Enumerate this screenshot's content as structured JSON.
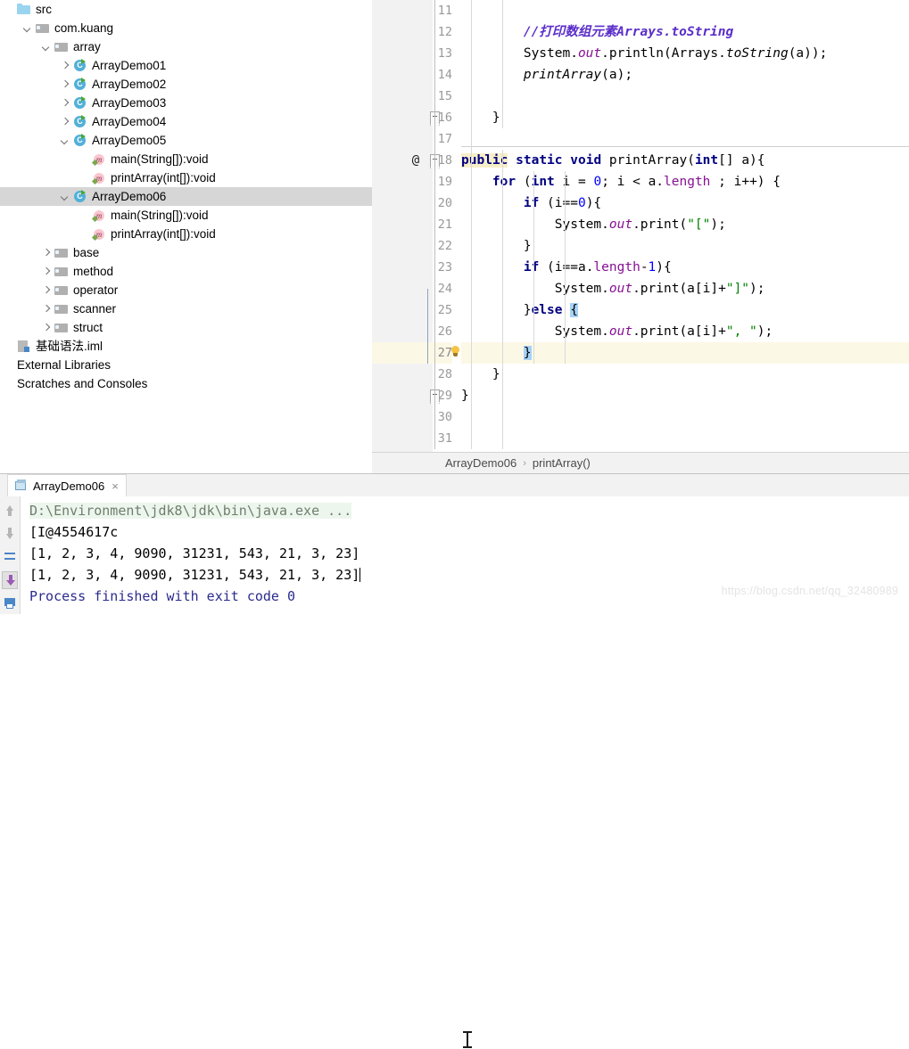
{
  "sidebar": {
    "items": [
      {
        "label": "src",
        "indent": 0,
        "arrow": "none",
        "icon": "folder-src-icon",
        "selected": false
      },
      {
        "label": "com.kuang",
        "indent": 1,
        "arrow": "down",
        "icon": "folder-pkg-icon",
        "selected": false
      },
      {
        "label": "array",
        "indent": 2,
        "arrow": "down",
        "icon": "folder-pkg-icon",
        "selected": false
      },
      {
        "label": "ArrayDemo01",
        "indent": 3,
        "arrow": "right",
        "icon": "java-class-icon",
        "selected": false
      },
      {
        "label": "ArrayDemo02",
        "indent": 3,
        "arrow": "right",
        "icon": "java-class-icon",
        "selected": false
      },
      {
        "label": "ArrayDemo03",
        "indent": 3,
        "arrow": "right",
        "icon": "java-class-icon",
        "selected": false
      },
      {
        "label": "ArrayDemo04",
        "indent": 3,
        "arrow": "right",
        "icon": "java-class-icon",
        "selected": false
      },
      {
        "label": "ArrayDemo05",
        "indent": 3,
        "arrow": "down",
        "icon": "java-class-icon",
        "selected": false
      },
      {
        "label": "main(String[]):void",
        "indent": 4,
        "arrow": "none",
        "icon": "method-icon",
        "selected": false
      },
      {
        "label": "printArray(int[]):void",
        "indent": 4,
        "arrow": "none",
        "icon": "method-icon",
        "selected": false
      },
      {
        "label": "ArrayDemo06",
        "indent": 3,
        "arrow": "down",
        "icon": "java-class-icon",
        "selected": true
      },
      {
        "label": "main(String[]):void",
        "indent": 4,
        "arrow": "none",
        "icon": "method-icon",
        "selected": false
      },
      {
        "label": "printArray(int[]):void",
        "indent": 4,
        "arrow": "none",
        "icon": "method-icon",
        "selected": false
      },
      {
        "label": "base",
        "indent": 2,
        "arrow": "right",
        "icon": "folder-pkg-icon",
        "selected": false
      },
      {
        "label": "method",
        "indent": 2,
        "arrow": "right",
        "icon": "folder-pkg-icon",
        "selected": false
      },
      {
        "label": "operator",
        "indent": 2,
        "arrow": "right",
        "icon": "folder-pkg-icon",
        "selected": false
      },
      {
        "label": "scanner",
        "indent": 2,
        "arrow": "right",
        "icon": "folder-pkg-icon",
        "selected": false
      },
      {
        "label": "struct",
        "indent": 2,
        "arrow": "right",
        "icon": "folder-pkg-icon",
        "selected": false
      },
      {
        "label": "基础语法.iml",
        "indent": 0,
        "arrow": "none",
        "icon": "iml-file-icon",
        "selected": false
      },
      {
        "label": "External Libraries",
        "indent": -1,
        "arrow": "none",
        "icon": "none",
        "selected": false
      },
      {
        "label": "Scratches and Consoles",
        "indent": -1,
        "arrow": "none",
        "icon": "none",
        "selected": false
      }
    ]
  },
  "editor": {
    "first_line_number": 11,
    "current_line": 27,
    "annotations": {
      "line18_marker": "@",
      "line27_intention": "lightbulb-icon"
    },
    "lines": [
      {
        "n": 11,
        "tokens": []
      },
      {
        "n": 12,
        "tokens": [
          {
            "t": "pl",
            "v": "        "
          },
          {
            "t": "cmt",
            "v": "//打印数组元素Arrays.toString"
          }
        ]
      },
      {
        "n": 13,
        "tokens": [
          {
            "t": "pl",
            "v": "        System."
          },
          {
            "t": "fld",
            "v": "out"
          },
          {
            "t": "pl",
            "v": ".println(Arrays."
          },
          {
            "t": "mth",
            "v": "toString"
          },
          {
            "t": "pl",
            "v": "(a));"
          }
        ]
      },
      {
        "n": 14,
        "tokens": [
          {
            "t": "pl",
            "v": "        "
          },
          {
            "t": "mth",
            "v": "printArray"
          },
          {
            "t": "pl",
            "v": "(a);"
          }
        ]
      },
      {
        "n": 15,
        "tokens": []
      },
      {
        "n": 16,
        "tokens": [
          {
            "t": "pl",
            "v": "    }"
          }
        ]
      },
      {
        "n": 17,
        "tokens": []
      },
      {
        "n": 18,
        "tokens": [
          {
            "t": "kw-hl",
            "v": "public"
          },
          {
            "t": "pl",
            "v": " "
          },
          {
            "t": "kw",
            "v": "static"
          },
          {
            "t": "pl",
            "v": " "
          },
          {
            "t": "kw",
            "v": "void"
          },
          {
            "t": "pl",
            "v": " printArray("
          },
          {
            "t": "kw",
            "v": "int"
          },
          {
            "t": "pl",
            "v": "[] a){"
          }
        ]
      },
      {
        "n": 19,
        "tokens": [
          {
            "t": "pl",
            "v": "    "
          },
          {
            "t": "kw",
            "v": "for"
          },
          {
            "t": "pl",
            "v": " ("
          },
          {
            "t": "kw",
            "v": "int"
          },
          {
            "t": "pl",
            "v": " i = "
          },
          {
            "t": "num",
            "v": "0"
          },
          {
            "t": "pl",
            "v": "; i < a."
          },
          {
            "t": "prop",
            "v": "length"
          },
          {
            "t": "pl",
            "v": " ; i++) {"
          }
        ]
      },
      {
        "n": 20,
        "tokens": [
          {
            "t": "pl",
            "v": "        "
          },
          {
            "t": "kw",
            "v": "if"
          },
          {
            "t": "pl",
            "v": " (i=="
          },
          {
            "t": "num",
            "v": "0"
          },
          {
            "t": "pl",
            "v": "){"
          }
        ]
      },
      {
        "n": 21,
        "tokens": [
          {
            "t": "pl",
            "v": "            System."
          },
          {
            "t": "fld",
            "v": "out"
          },
          {
            "t": "pl",
            "v": ".print("
          },
          {
            "t": "str",
            "v": "\"[\""
          },
          {
            "t": "pl",
            "v": ");"
          }
        ]
      },
      {
        "n": 22,
        "tokens": [
          {
            "t": "pl",
            "v": "        }"
          }
        ]
      },
      {
        "n": 23,
        "tokens": [
          {
            "t": "pl",
            "v": "        "
          },
          {
            "t": "kw",
            "v": "if"
          },
          {
            "t": "pl",
            "v": " (i==a."
          },
          {
            "t": "prop",
            "v": "length"
          },
          {
            "t": "pl",
            "v": "-"
          },
          {
            "t": "num",
            "v": "1"
          },
          {
            "t": "pl",
            "v": "){"
          }
        ]
      },
      {
        "n": 24,
        "tokens": [
          {
            "t": "pl",
            "v": "            System."
          },
          {
            "t": "fld",
            "v": "out"
          },
          {
            "t": "pl",
            "v": ".print(a[i]+"
          },
          {
            "t": "str",
            "v": "\"]\""
          },
          {
            "t": "pl",
            "v": ");"
          }
        ]
      },
      {
        "n": 25,
        "tokens": [
          {
            "t": "pl",
            "v": "        }"
          },
          {
            "t": "kw",
            "v": "else"
          },
          {
            "t": "pl",
            "v": " "
          },
          {
            "t": "brc-hl",
            "v": "{"
          }
        ]
      },
      {
        "n": 26,
        "tokens": [
          {
            "t": "pl",
            "v": "            System."
          },
          {
            "t": "fld",
            "v": "out"
          },
          {
            "t": "pl",
            "v": ".print(a[i]+"
          },
          {
            "t": "str",
            "v": "\", \""
          },
          {
            "t": "pl",
            "v": ");"
          }
        ]
      },
      {
        "n": 27,
        "tokens": [
          {
            "t": "pl",
            "v": "        "
          },
          {
            "t": "brc-hl",
            "v": "}"
          }
        ]
      },
      {
        "n": 28,
        "tokens": [
          {
            "t": "pl",
            "v": "    }"
          }
        ]
      },
      {
        "n": 29,
        "tokens": [
          {
            "t": "pl",
            "v": "}"
          }
        ]
      },
      {
        "n": 30,
        "tokens": []
      },
      {
        "n": 31,
        "tokens": []
      }
    ]
  },
  "breadcrumb": {
    "class": "ArrayDemo06",
    "separator": "›",
    "member": "printArray()"
  },
  "run_panel": {
    "tab_label": "ArrayDemo06",
    "tab_close": "×",
    "tools": [
      {
        "name": "rerun-up-icon"
      },
      {
        "name": "rerun-down-icon"
      },
      {
        "name": "soft-wrap-icon"
      },
      {
        "name": "scroll-to-end-icon"
      },
      {
        "name": "print-icon"
      }
    ],
    "console_lines": [
      {
        "style": "cmd",
        "text": "D:\\Environment\\jdk8\\jdk\\bin\\java.exe ..."
      },
      {
        "style": "out",
        "text": "[I@4554617c"
      },
      {
        "style": "out",
        "text": "[1, 2, 3, 4, 9090, 31231, 543, 21, 3, 23]"
      },
      {
        "style": "out",
        "text": "[1, 2, 3, 4, 9090, 31231, 543, 21, 3, 23]",
        "caret": true
      },
      {
        "style": "done",
        "text": "Process finished with exit code 0"
      }
    ]
  },
  "watermark": "https://blog.csdn.net/qq_32480989",
  "colors": {
    "keyword": "#000080",
    "string": "#008000",
    "number": "#0000ff",
    "comment": "#5b2ec9",
    "static_field": "#871094",
    "selection": "#d6d6d6",
    "current_line": "#fcf8e6",
    "brace_match": "#a6d2f5",
    "console_cmd": "#6e7e6e",
    "console_done": "#2b2b8f"
  }
}
